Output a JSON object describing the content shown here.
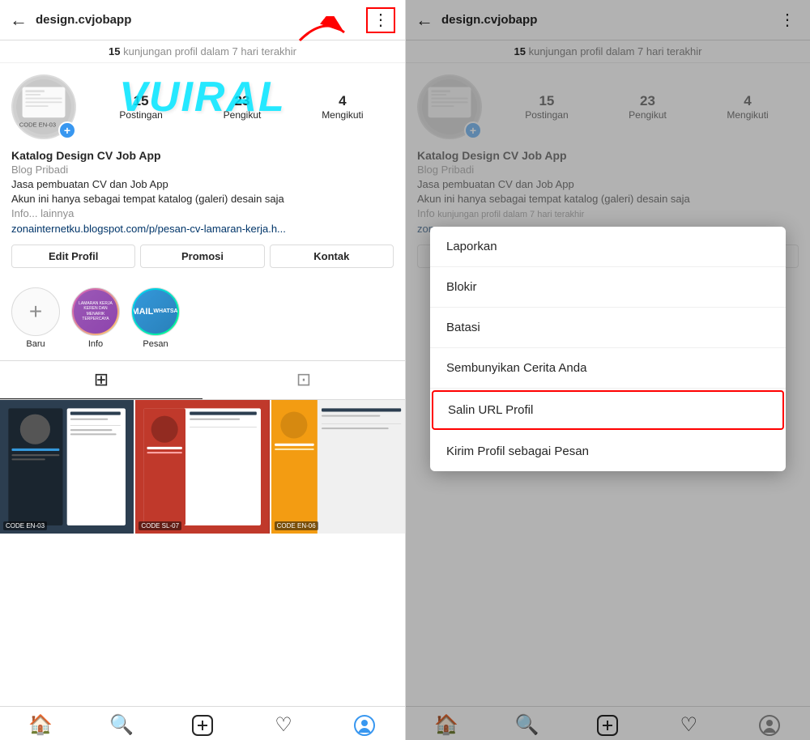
{
  "left_panel": {
    "header": {
      "back_icon": "←",
      "title": "design.cvjobapp",
      "dots_icon": "⋮"
    },
    "visit_notice": {
      "count": "15",
      "text": "kunjungan profil dalam 7 hari terakhir"
    },
    "stats": {
      "posts": {
        "number": "15",
        "label": "Postingan"
      },
      "followers": {
        "number": "23",
        "label": "Pengikut"
      },
      "following": {
        "number": "4",
        "label": "Mengikuti"
      }
    },
    "bio": {
      "name": "Katalog Design CV Job App",
      "type": "Blog Pribadi",
      "line1": "Jasa pembuatan CV dan Job App",
      "line2": "Akun ini hanya sebagai tempat katalog (galeri) desain saja",
      "line3": "Info... lainnya",
      "link": "zonainternetku.blogspot.com/p/pesan-cv-lamaran-kerja.h..."
    },
    "buttons": {
      "edit": "Edit Profil",
      "promote": "Promosi",
      "contact": "Kontak"
    },
    "stories": [
      {
        "type": "new",
        "label": "Baru"
      },
      {
        "type": "lamaran",
        "label": "Info"
      },
      {
        "type": "email",
        "label": "Pesan"
      }
    ],
    "tabs": {
      "grid": "⊞",
      "tag": "⊡"
    },
    "posts": [
      {
        "color": "dark",
        "code": "CODE EN-03"
      },
      {
        "color": "red",
        "code": "CODE SL-07"
      },
      {
        "color": "yellow",
        "code": "CODE EN-06"
      }
    ],
    "bottom_nav": [
      "🏠",
      "🔍",
      "⊕",
      "♡",
      "👤"
    ]
  },
  "right_panel": {
    "header": {
      "back_icon": "←",
      "title": "design.cvjobapp",
      "dots_icon": "⋮"
    },
    "visit_notice": {
      "count": "15",
      "text": "kunjungan profil dalam 7 hari terakhir"
    },
    "dropdown": {
      "items": [
        {
          "label": "Laporkan",
          "highlighted": false
        },
        {
          "label": "Blokir",
          "highlighted": false
        },
        {
          "label": "Batasi",
          "highlighted": false
        },
        {
          "label": "Sembunyikan Cerita Anda",
          "highlighted": false
        },
        {
          "label": "Salin URL Profil",
          "highlighted": true
        },
        {
          "label": "Kirim Profil sebagai Pesan",
          "highlighted": false
        }
      ]
    },
    "bottom_nav": [
      "🏠",
      "🔍",
      "⊕",
      "♡",
      "👤"
    ]
  },
  "watermark": "VUIRAL"
}
